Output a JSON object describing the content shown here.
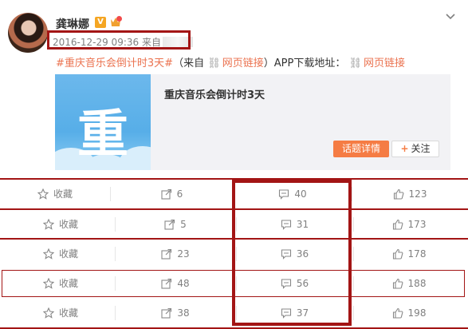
{
  "post": {
    "author": "龚琳娜",
    "badge_v": "V",
    "timestamp": "2016-12-29 09:36",
    "source_prefix": "来自",
    "text": {
      "hashtag": "#重庆音乐会倒计时3天#",
      "paren_open": "（来自",
      "link1": "网页链接",
      "middle": "）APP下载地址：",
      "link2": "网页链接"
    },
    "topic_card": {
      "thumb_char": "重",
      "title": "重庆音乐会倒计时3天",
      "detail_button": "话题详情",
      "follow_button": "关注"
    }
  },
  "action_rows": [
    {
      "favorite": "收藏",
      "forward": "6",
      "comment": "40",
      "like": "123"
    },
    {
      "favorite": "收藏",
      "forward": "5",
      "comment": "31",
      "like": "173"
    },
    {
      "favorite": "收藏",
      "forward": "23",
      "comment": "36",
      "like": "178"
    },
    {
      "favorite": "收藏",
      "forward": "48",
      "comment": "56",
      "like": "188"
    },
    {
      "favorite": "收藏",
      "forward": "38",
      "comment": "37",
      "like": "198"
    }
  ],
  "colors": {
    "accent_orange": "#eb7350",
    "button_orange": "#f57c44",
    "highlight_red": "#a31515",
    "thumb_blue": "#5aaee8"
  },
  "icons": {
    "header_menu": "chevron-down-icon",
    "link": "link-icon",
    "favorite": "star-icon",
    "forward": "forward-icon",
    "comment": "comment-icon",
    "like": "thumbs-up-icon"
  }
}
